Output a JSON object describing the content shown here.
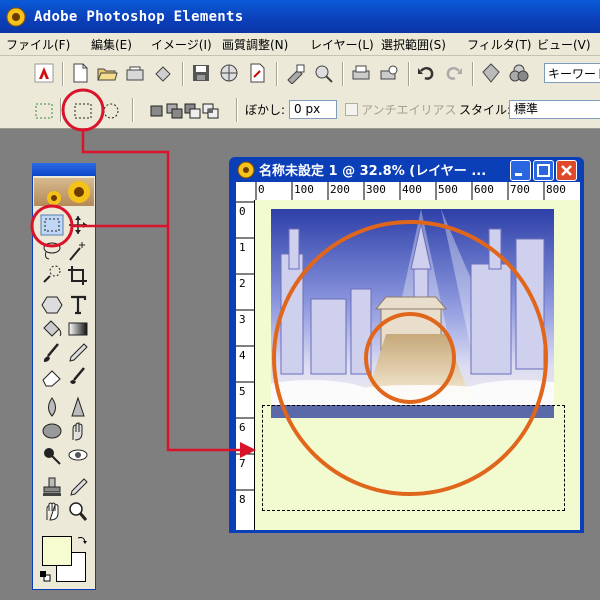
{
  "app": {
    "title": "Adobe Photoshop Elements"
  },
  "menu": [
    {
      "label": "ファイル(F)"
    },
    {
      "label": "編集(E)"
    },
    {
      "label": "イメージ(I)"
    },
    {
      "label": "画質調整(N)"
    },
    {
      "label": "レイヤー(L)"
    },
    {
      "label": "選択範囲(S)"
    },
    {
      "label": "フィルタ(T)"
    },
    {
      "label": "ビュー(V)"
    }
  ],
  "toolbar": {
    "keyword_placeholder": "キーワード"
  },
  "options": {
    "feather_label": "ぼかし:",
    "feather_value": "0 px",
    "antialias_label": "アンチエイリアス",
    "style_label": "スタイル:",
    "style_value": "標準"
  },
  "document": {
    "title": "名称未設定 1 @ 32.8% (レイヤー ...",
    "zoom_percent": 32.8,
    "ruler_top": [
      "0",
      "100",
      "200",
      "300",
      "400",
      "500",
      "600",
      "700",
      "800"
    ],
    "ruler_left": [
      "0",
      "1",
      "2",
      "3",
      "4",
      "5",
      "6",
      "7",
      "8"
    ]
  },
  "colors": {
    "title_blue": "#0b3fb8",
    "annotation_red": "#d9142a",
    "annotation_orange": "#e0661c",
    "canvas_bg": "#f2fbd0",
    "foreground_swatch": "#f6fbd0",
    "background_swatch": "#ffffff"
  }
}
